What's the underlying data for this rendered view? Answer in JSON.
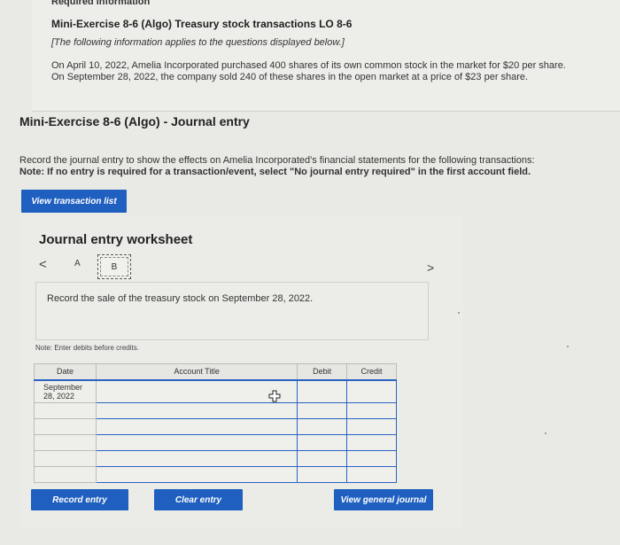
{
  "header": {
    "required_info": "Required information",
    "exercise_title": "Mini-Exercise 8-6 (Algo) Treasury stock transactions LO 8-6",
    "info_note": "[The following information applies to the questions displayed below.]",
    "paragraph_line1": "On April 10, 2022, Amelia Incorporated purchased 400 shares of its own common stock in the market for $20 per share.",
    "paragraph_line2": "On September 28, 2022, the company sold 240 of these shares in the open market at a price of $23 per share."
  },
  "section": {
    "title": "Mini-Exercise 8-6 (Algo) - Journal entry",
    "instruction": "Record the journal entry to show the effects on Amelia Incorporated's financial statements for the following transactions:",
    "note": "Note: If no entry is required for a transaction/event, select \"No journal entry required\" in the first account field."
  },
  "buttons": {
    "view_transaction_list": "View transaction list",
    "record_entry": "Record entry",
    "clear_entry": "Clear entry",
    "view_general_journal": "View general journal"
  },
  "worksheet": {
    "title": "Journal entry worksheet",
    "nav_prev": "<",
    "nav_next": ">",
    "tabs": [
      "A",
      "B"
    ],
    "prompt": "Record the sale of the treasury stock on September 28, 2022.",
    "note_debits": "Note: Enter debits before credits."
  },
  "journal": {
    "headers": {
      "date": "Date",
      "account": "Account Title",
      "debit": "Debit",
      "credit": "Credit"
    },
    "date_line1": "September",
    "date_line2": "28, 2022"
  },
  "colors": {
    "button_blue": "#1f5fbf",
    "accent_blue": "#2a64c0"
  }
}
